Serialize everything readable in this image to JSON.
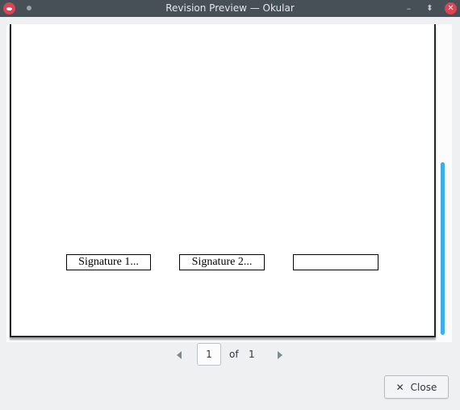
{
  "window": {
    "title": "Revision Preview — Okular",
    "app_icon": "okular-eye-icon",
    "controls": {
      "minimize": "minimize-icon",
      "maximize": "maximize-icon",
      "close": "close-icon"
    }
  },
  "document": {
    "signature_fields": [
      {
        "label": "Signature 1..."
      },
      {
        "label": "Signature 2..."
      },
      {
        "label": ""
      }
    ]
  },
  "pager": {
    "current_page": "1",
    "of_label": "of",
    "total_pages": "1"
  },
  "dialog": {
    "close_label": "Close"
  },
  "colors": {
    "titlebar": "#475057",
    "scroll_handle": "#3daee9",
    "window_close": "#da4453"
  }
}
